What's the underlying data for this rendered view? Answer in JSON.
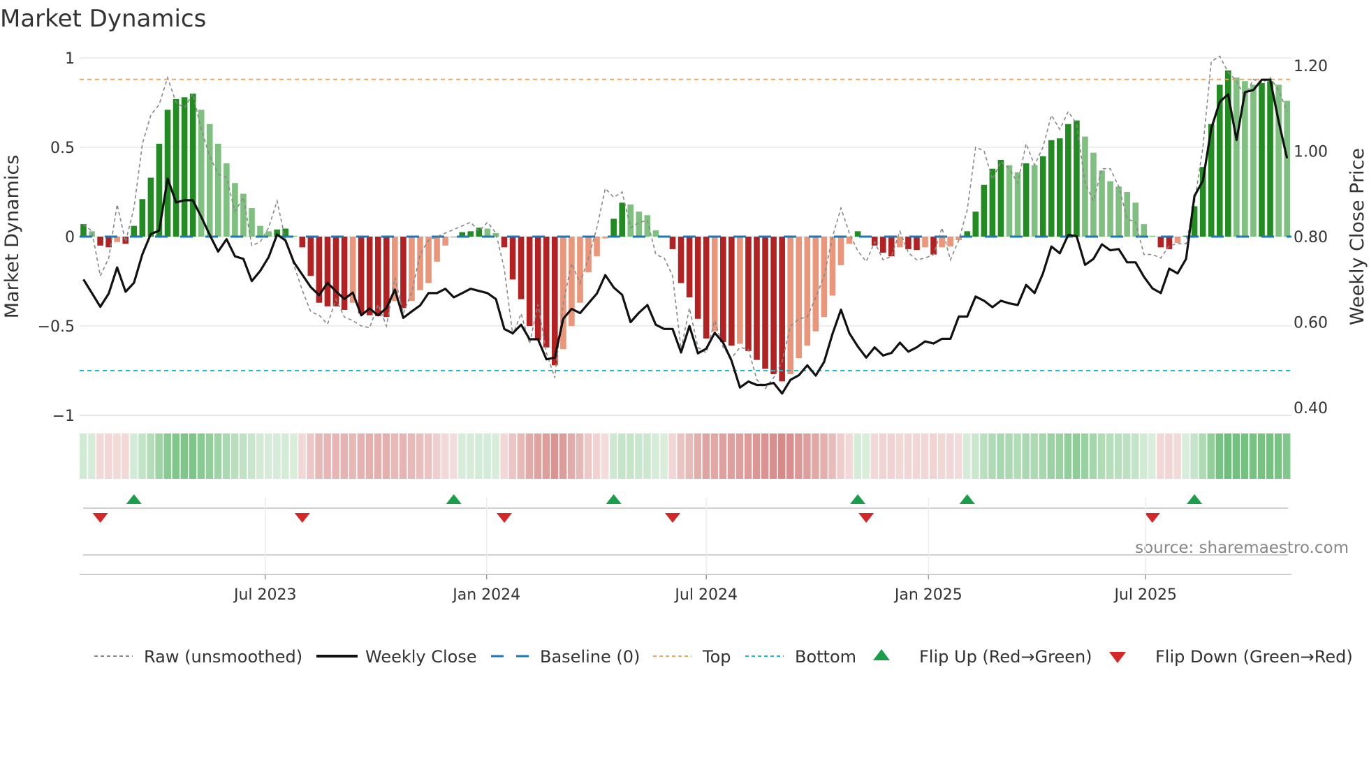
{
  "chart_data": {
    "type": "bar",
    "title": "Market Dynamics",
    "ylabel": "Market Dynamics",
    "y2label": "Weekly Close Price",
    "source": "source: sharemaestro.com",
    "ylim": [
      -1,
      1
    ],
    "y2lim": [
      0.4,
      1.2
    ],
    "y_ticks": [
      "1",
      "0.5",
      "0",
      "−0.5",
      "−1"
    ],
    "y_tick_values": [
      1,
      0.5,
      0,
      -0.5,
      -1
    ],
    "y2_ticks": [
      "1.20",
      "1.00",
      "0.80",
      "0.60",
      "0.40"
    ],
    "y2_tick_values": [
      1.2,
      1.0,
      0.8,
      0.6,
      0.4
    ],
    "x_unit": "week index",
    "x_ticks": [
      {
        "label": "Jul 2023",
        "week": 21.6
      },
      {
        "label": "Jan 2024",
        "week": 47.9
      },
      {
        "label": "Jul 2024",
        "week": 74.0
      },
      {
        "label": "Jan 2025",
        "week": 100.4
      },
      {
        "label": "Jul 2025",
        "week": 126.2
      }
    ],
    "top_level": 0.88,
    "bottom_level": -0.75,
    "baseline": 0,
    "colors": {
      "up_strong": "#228b22",
      "up_weak": "#7fbf7f",
      "down_strong": "#b22222",
      "down_weak": "#e9967a",
      "raw": "#888888",
      "close": "#111111",
      "baseline": "#1f77b4",
      "top": "#f4a460",
      "bottom": "#17becf",
      "flip_up": "#1a9e4a",
      "flip_down": "#d62728",
      "strip_green": "#4caf5a",
      "strip_red": "#c8605c"
    },
    "dynamics": [
      0.07,
      0.03,
      -0.05,
      -0.06,
      -0.03,
      -0.04,
      0.06,
      0.21,
      0.33,
      0.52,
      0.71,
      0.77,
      0.78,
      0.8,
      0.71,
      0.63,
      0.52,
      0.41,
      0.3,
      0.24,
      0.16,
      0.06,
      0.03,
      0.04,
      0.045,
      0.005,
      -0.06,
      -0.22,
      -0.37,
      -0.39,
      -0.39,
      -0.41,
      -0.37,
      -0.43,
      -0.44,
      -0.445,
      -0.45,
      -0.36,
      -0.4,
      -0.36,
      -0.3,
      -0.26,
      -0.14,
      -0.05,
      -0.005,
      0.025,
      0.03,
      0.05,
      0.045,
      0.02,
      -0.06,
      -0.24,
      -0.35,
      -0.5,
      -0.58,
      -0.62,
      -0.72,
      -0.63,
      -0.5,
      -0.37,
      -0.2,
      -0.11,
      -0.01,
      0.1,
      0.19,
      0.18,
      0.14,
      0.12,
      0.035,
      0.003,
      -0.07,
      -0.26,
      -0.34,
      -0.46,
      -0.57,
      -0.53,
      -0.59,
      -0.61,
      -0.6,
      -0.64,
      -0.69,
      -0.74,
      -0.77,
      -0.81,
      -0.77,
      -0.68,
      -0.61,
      -0.53,
      -0.45,
      -0.33,
      -0.16,
      -0.04,
      0.03,
      0.003,
      -0.05,
      -0.09,
      -0.11,
      -0.06,
      -0.07,
      -0.075,
      -0.06,
      -0.1,
      -0.06,
      -0.055,
      -0.02,
      0.03,
      0.14,
      0.29,
      0.38,
      0.43,
      0.4,
      0.36,
      0.41,
      0.4,
      0.45,
      0.54,
      0.55,
      0.63,
      0.65,
      0.56,
      0.47,
      0.37,
      0.31,
      0.28,
      0.25,
      0.19,
      0.07,
      0.005,
      -0.06,
      -0.07,
      -0.035,
      0.005,
      0.17,
      0.39,
      0.63,
      0.85,
      0.93,
      0.89,
      0.87,
      0.85,
      0.86,
      0.87,
      0.85,
      0.76
    ],
    "raw": [
      0.07,
      0.03,
      -0.22,
      -0.12,
      0.18,
      -0.03,
      0.16,
      0.52,
      0.68,
      0.74,
      0.89,
      0.75,
      0.72,
      0.8,
      0.6,
      0.45,
      0.35,
      0.33,
      0.14,
      0.22,
      -0.05,
      -0.03,
      0.05,
      0.2,
      -0.02,
      -0.16,
      -0.3,
      -0.42,
      -0.44,
      -0.49,
      -0.35,
      -0.45,
      -0.47,
      -0.5,
      -0.51,
      -0.38,
      -0.5,
      -0.23,
      -0.43,
      -0.31,
      -0.1,
      -0.02,
      0.0,
      0.02,
      0.04,
      0.06,
      0.08,
      0.03,
      0.08,
      0.02,
      -0.18,
      -0.55,
      -0.43,
      -0.6,
      -0.38,
      -0.65,
      -0.79,
      -0.37,
      -0.15,
      -0.26,
      -0.12,
      0.05,
      0.27,
      0.22,
      0.25,
      0.05,
      0.08,
      0.09,
      -0.1,
      -0.12,
      -0.22,
      -0.63,
      -0.4,
      -0.62,
      -0.65,
      -0.47,
      -0.62,
      -0.68,
      -0.62,
      -0.63,
      -0.8,
      -0.85,
      -0.79,
      -0.7,
      -0.5,
      -0.46,
      -0.45,
      -0.34,
      -0.22,
      0.0,
      0.16,
      0.02,
      -0.08,
      -0.14,
      -0.03,
      -0.13,
      -0.11,
      0.03,
      -0.09,
      -0.13,
      -0.12,
      -0.1,
      0.05,
      -0.13,
      -0.02,
      0.15,
      0.5,
      0.48,
      0.32,
      0.42,
      0.38,
      0.3,
      0.52,
      0.4,
      0.5,
      0.68,
      0.6,
      0.7,
      0.63,
      0.3,
      0.2,
      0.38,
      0.38,
      0.28,
      0.1,
      0.08,
      -0.1,
      -0.1,
      -0.12,
      -0.05,
      -0.04,
      -0.04,
      0.19,
      0.5,
      0.98,
      1.01,
      0.92,
      0.87,
      0.78,
      0.88,
      0.86,
      0.89,
      0.82,
      0.7
    ],
    "close": [
      0.7,
      0.668,
      0.636,
      0.667,
      0.728,
      0.671,
      0.692,
      0.759,
      0.806,
      0.814,
      0.936,
      0.88,
      0.885,
      0.885,
      0.846,
      0.804,
      0.765,
      0.794,
      0.754,
      0.748,
      0.696,
      0.72,
      0.752,
      0.805,
      0.791,
      0.74,
      0.711,
      0.682,
      0.663,
      0.692,
      0.672,
      0.654,
      0.669,
      0.616,
      0.632,
      0.616,
      0.633,
      0.676,
      0.61,
      0.625,
      0.639,
      0.668,
      0.668,
      0.678,
      0.658,
      0.668,
      0.678,
      0.673,
      0.668,
      0.654,
      0.584,
      0.574,
      0.594,
      0.56,
      0.56,
      0.513,
      0.517,
      0.608,
      0.631,
      0.621,
      0.644,
      0.667,
      0.71,
      0.681,
      0.664,
      0.6,
      0.622,
      0.64,
      0.594,
      0.584,
      0.584,
      0.529,
      0.591,
      0.527,
      0.538,
      0.575,
      0.552,
      0.51,
      0.447,
      0.461,
      0.453,
      0.453,
      0.458,
      0.433,
      0.465,
      0.476,
      0.499,
      0.475,
      0.507,
      0.573,
      0.629,
      0.574,
      0.543,
      0.517,
      0.541,
      0.522,
      0.528,
      0.552,
      0.531,
      0.541,
      0.555,
      0.55,
      0.561,
      0.561,
      0.613,
      0.613,
      0.66,
      0.65,
      0.635,
      0.65,
      0.644,
      0.64,
      0.687,
      0.668,
      0.714,
      0.777,
      0.761,
      0.804,
      0.801,
      0.734,
      0.748,
      0.782,
      0.768,
      0.771,
      0.74,
      0.74,
      0.706,
      0.679,
      0.668,
      0.725,
      0.714,
      0.748,
      0.895,
      0.931,
      1.053,
      1.115,
      1.133,
      1.026,
      1.138,
      1.143,
      1.167,
      1.167,
      1.07,
      0.983
    ],
    "flip_up_weeks": [
      6,
      44,
      63,
      92,
      105,
      132
    ],
    "flip_down_weeks": [
      2,
      26,
      50,
      70,
      93,
      127
    ],
    "legend": {
      "placement": "bottom",
      "items": [
        {
          "label": "Raw (unsmoothed)",
          "kind": "raw"
        },
        {
          "label": "Weekly Close",
          "kind": "close"
        },
        {
          "label": "Baseline (0)",
          "kind": "baseline"
        },
        {
          "label": "Top",
          "kind": "top"
        },
        {
          "label": "Bottom",
          "kind": "bottom"
        },
        {
          "label": "Flip Up (Red→Green)",
          "kind": "flip_up"
        },
        {
          "label": "Flip Down (Green→Red)",
          "kind": "flip_down"
        }
      ]
    },
    "grid": true
  }
}
